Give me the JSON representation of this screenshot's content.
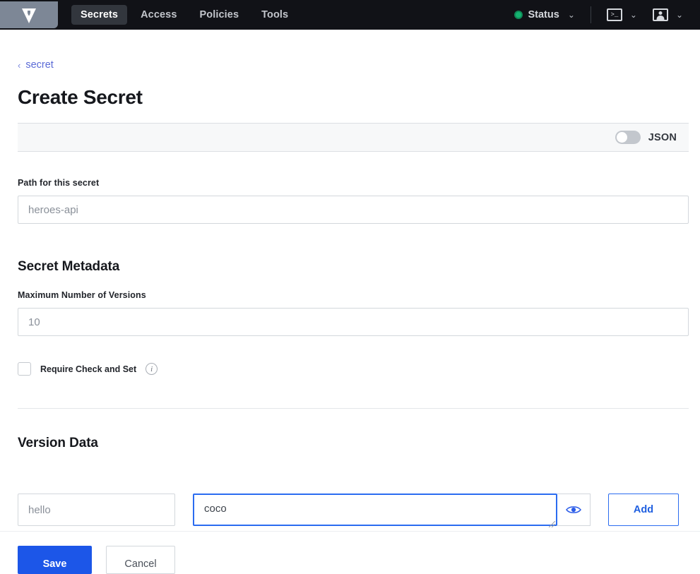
{
  "navbar": {
    "logo_name": "vault-logo",
    "tabs": [
      {
        "label": "Secrets",
        "active": true
      },
      {
        "label": "Access",
        "active": false
      },
      {
        "label": "Policies",
        "active": false
      },
      {
        "label": "Tools",
        "active": false
      }
    ],
    "status": {
      "label": "Status",
      "dot_color": "#15b371",
      "chevron": "⌄"
    },
    "console_chevron": "⌄",
    "console_glyph": ">_",
    "user_chevron": "⌄"
  },
  "breadcrumb": {
    "chevron": "‹",
    "label": "secret"
  },
  "page": {
    "title": "Create Secret"
  },
  "toolbar": {
    "json_label": "JSON",
    "json_enabled": false
  },
  "path_field": {
    "label": "Path for this secret",
    "placeholder": "heroes-api",
    "value": ""
  },
  "secret_metadata": {
    "title": "Secret Metadata",
    "max_versions": {
      "label": "Maximum Number of Versions",
      "placeholder": "10",
      "value": ""
    },
    "check_and_set": {
      "label": "Require Check and Set",
      "checked": false,
      "info_glyph": "i"
    }
  },
  "version_data": {
    "title": "Version Data",
    "key_placeholder": "hello",
    "key_value": "",
    "value_placeholder": "",
    "value_value": "coco",
    "show_value_label": "eye-icon",
    "add_label": "Add"
  },
  "actions": {
    "save_label": "Save",
    "cancel_label": "Cancel"
  },
  "colors": {
    "accent": "#1c56e8",
    "link": "#5b6bd6",
    "nav_bg": "#111217",
    "status_green": "#15b371",
    "focus_border": "#2b6cf0"
  }
}
